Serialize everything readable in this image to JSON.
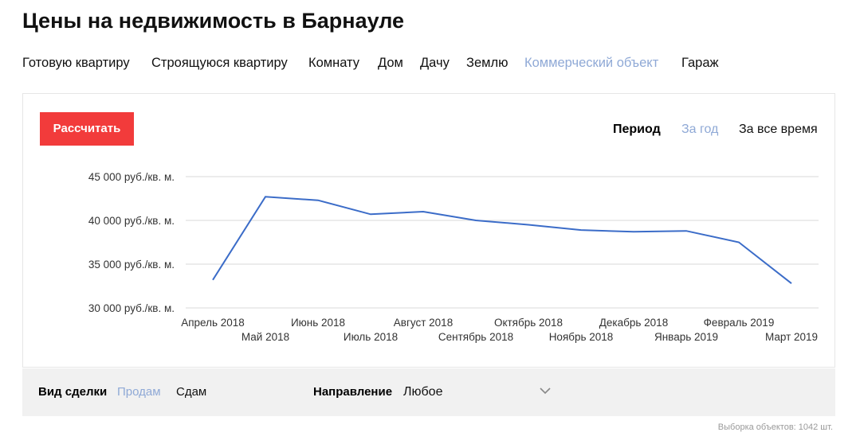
{
  "page": {
    "title": "Цены на недвижимость в Барнауле"
  },
  "nav": {
    "items": [
      {
        "label": "Готовую квартиру",
        "active": false
      },
      {
        "label": "Строящуюся квартиру",
        "active": false
      },
      {
        "label": "Комнату",
        "active": false
      },
      {
        "label": "Дом",
        "active": false
      },
      {
        "label": "Дачу",
        "active": false
      },
      {
        "label": "Землю",
        "active": false
      },
      {
        "label": "Коммерческий объект",
        "active": true
      },
      {
        "label": "Гараж",
        "active": false
      }
    ]
  },
  "toolbar": {
    "calc_label": "Рассчитать",
    "period_label": "Период",
    "period_options": [
      {
        "label": "За год",
        "active": true
      },
      {
        "label": "За все время",
        "active": false
      }
    ]
  },
  "chart_data": {
    "type": "line",
    "x": [
      "Апрель 2018",
      "Май 2018",
      "Июнь 2018",
      "Июль 2018",
      "Август 2018",
      "Сентябрь 2018",
      "Октябрь 2018",
      "Ноябрь 2018",
      "Декабрь 2018",
      "Январь 2019",
      "Февраль 2019",
      "Март 2019"
    ],
    "series": [
      {
        "values": [
          33200,
          42700,
          42300,
          40700,
          41000,
          40000,
          39500,
          38900,
          38700,
          38800,
          37500,
          32800
        ]
      }
    ],
    "y_ticks": [
      "30 000 руб./кв. м.",
      "35 000 руб./кв. м.",
      "40 000 руб./кв. м.",
      "45 000 руб./кв. м."
    ],
    "y_tick_values": [
      30000,
      35000,
      40000,
      45000
    ],
    "ylim": [
      30000,
      45000
    ],
    "grid": true,
    "line_color": "#3b6cc8"
  },
  "filters": {
    "deal_label": "Вид сделки",
    "deal_options": [
      {
        "label": "Продам",
        "active": true
      },
      {
        "label": "Сдам",
        "active": false
      }
    ],
    "direction_label": "Направление",
    "direction_value": "Любое"
  },
  "footer": {
    "sample_text": "Выборка объектов: 1042 шт."
  },
  "colors": {
    "accent_red": "#f23b3b",
    "active_link": "#8fa9d6",
    "filter_bg": "#f1f1f1"
  }
}
